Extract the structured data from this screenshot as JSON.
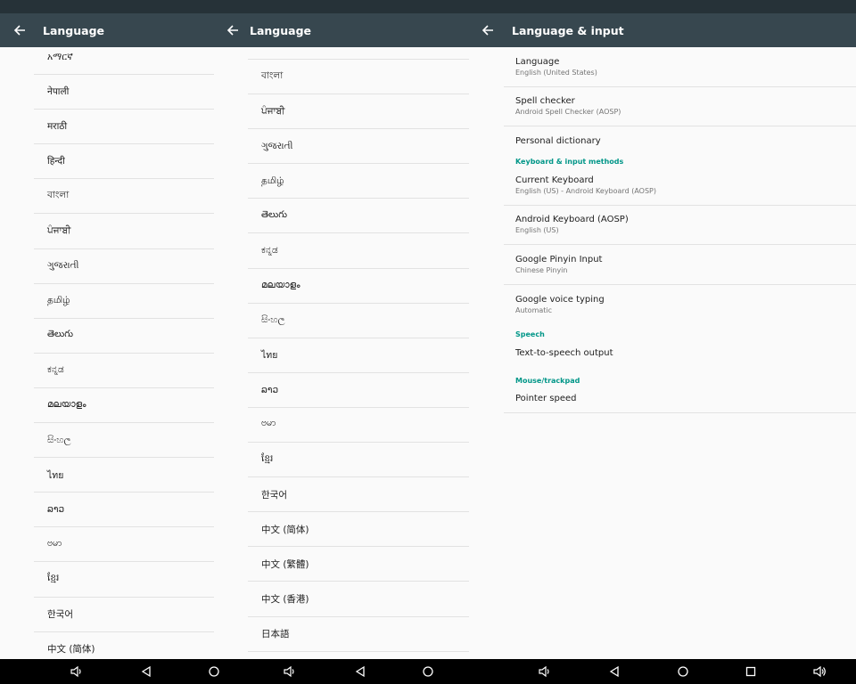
{
  "left_screen": {
    "title": "Language",
    "items": [
      "አማርኛ",
      "नेपाली",
      "मराठी",
      "हिन्दी",
      "বাংলা",
      "ਪੰਜਾਬੀ",
      "ગુજરાતી",
      "தமிழ்",
      "తెలుగు",
      "ಕನ್ನಡ",
      "മലയാളം",
      "සිංහල",
      "ไทย",
      "ລາວ",
      "ဗမာ",
      "ខ្មែរ",
      "한국어",
      "中文 (简体)"
    ]
  },
  "middle_screen": {
    "title": "Language",
    "items": [
      "বাংলা",
      "ਪੰਜਾਬੀ",
      "ગુજરાતી",
      "தமிழ்",
      "తెలుగు",
      "ಕನ್ನಡ",
      "മലയാളം",
      "සිංහල",
      "ไทย",
      "ລາວ",
      "ဗမာ",
      "ខ្មែរ",
      "한국어",
      "中文 (简体)",
      "中文 (繁體)",
      "中文 (香港)",
      "日本語"
    ]
  },
  "right_screen": {
    "title": "Language & input",
    "language": {
      "title": "Language",
      "summary": "English (United States)"
    },
    "spell_checker": {
      "title": "Spell checker",
      "summary": "Android Spell Checker (AOSP)"
    },
    "personal_dictionary": {
      "title": "Personal dictionary"
    },
    "cat_keyboard": "Keyboard & input methods",
    "current_keyboard": {
      "title": "Current Keyboard",
      "summary": "English (US) - Android Keyboard (AOSP)"
    },
    "android_keyboard": {
      "title": "Android Keyboard (AOSP)",
      "summary": "English (US)"
    },
    "pinyin": {
      "title": "Google Pinyin Input",
      "summary": "Chinese Pinyin"
    },
    "voice": {
      "title": "Google voice typing",
      "summary": "Automatic"
    },
    "cat_speech": "Speech",
    "tts": {
      "title": "Text-to-speech output"
    },
    "cat_mouse": "Mouse/trackpad",
    "pointer": {
      "title": "Pointer speed"
    }
  },
  "colors": {
    "appbar": "#37474f",
    "statusbar": "#263238",
    "accent": "#009688",
    "background": "#fafafa"
  },
  "icons": [
    "back-arrow-icon",
    "volume-icon",
    "nav-back-icon",
    "nav-home-icon",
    "nav-recents-icon"
  ]
}
